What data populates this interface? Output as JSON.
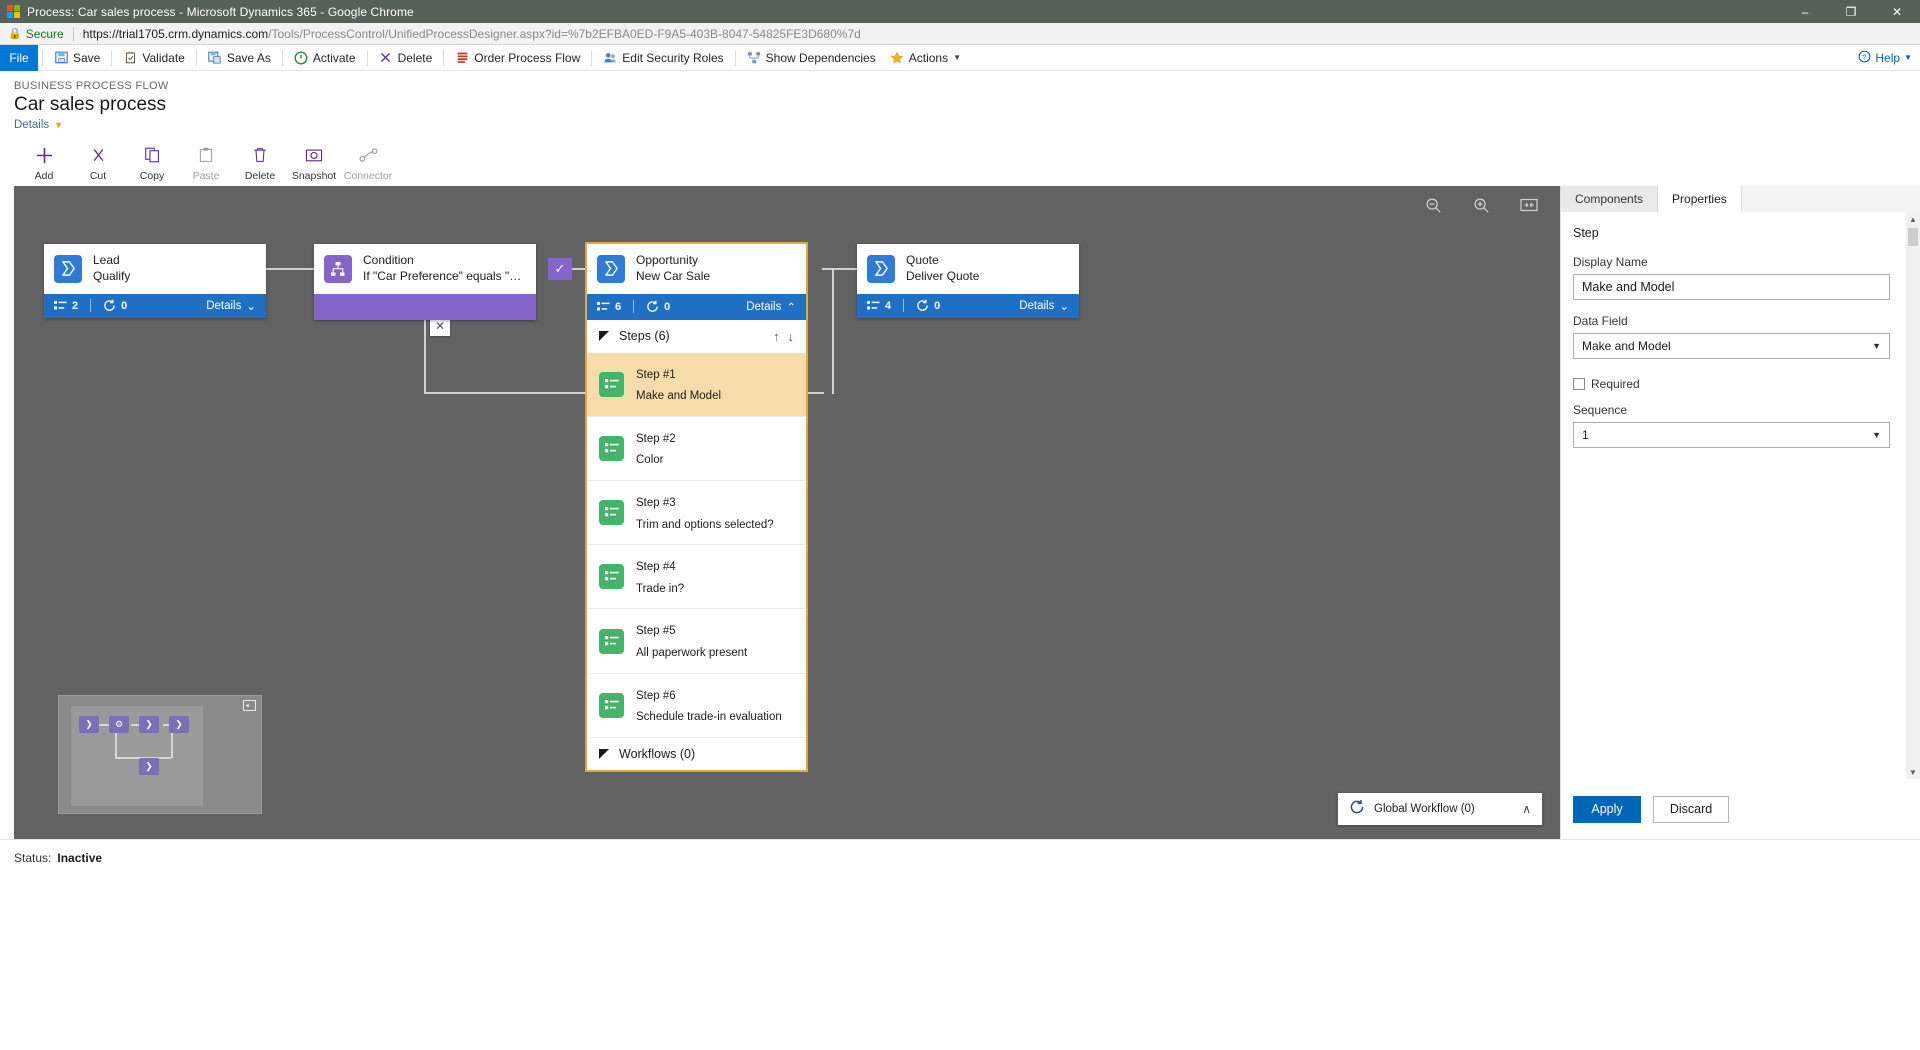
{
  "window": {
    "title": "Process: Car sales process - Microsoft Dynamics 365 - Google Chrome",
    "minimize": "–",
    "maximize": "❐",
    "close": "✕"
  },
  "address": {
    "secure_label": "Secure",
    "url_host": "https://trial1705.crm.dynamics.com",
    "url_path": "/Tools/ProcessControl/UnifiedProcessDesigner.aspx?id=%7b2EFBA0ED-F9A5-403B-8047-54825FE3D680%7d"
  },
  "commandbar": {
    "file": "File",
    "items": [
      {
        "label": "Save",
        "icon": "save-icon"
      },
      {
        "label": "Validate",
        "icon": "validate-icon"
      },
      {
        "label": "Save As",
        "icon": "save-as-icon"
      },
      {
        "label": "Activate",
        "icon": "activate-icon"
      },
      {
        "label": "Delete",
        "icon": "delete-icon"
      },
      {
        "label": "Order Process Flow",
        "icon": "order-process-flow-icon"
      },
      {
        "label": "Edit Security Roles",
        "icon": "edit-security-roles-icon"
      },
      {
        "label": "Show Dependencies",
        "icon": "show-dependencies-icon"
      },
      {
        "label": "Actions",
        "icon": "actions-icon"
      }
    ],
    "help": "Help"
  },
  "header": {
    "kicker": "BUSINESS PROCESS FLOW",
    "title": "Car sales process",
    "details": "Details"
  },
  "designtools": [
    {
      "label": "Add",
      "icon": "plus-icon",
      "disabled": false
    },
    {
      "label": "Cut",
      "icon": "scissors-icon",
      "disabled": false
    },
    {
      "label": "Copy",
      "icon": "copy-icon",
      "disabled": false
    },
    {
      "label": "Paste",
      "icon": "paste-icon",
      "disabled": true
    },
    {
      "label": "Delete",
      "icon": "trash-icon",
      "disabled": false
    },
    {
      "label": "Snapshot",
      "icon": "camera-icon",
      "disabled": false
    },
    {
      "label": "Connector",
      "icon": "connector-icon",
      "disabled": true
    }
  ],
  "canvas": {
    "zoom_out": "zoom-out-icon",
    "zoom_in": "zoom-in-icon",
    "fit": "fit-to-screen-icon",
    "stages": [
      {
        "name": "Lead",
        "subtitle": "Qualify",
        "steps_count": "2",
        "workflows_count": "0",
        "details": "Details",
        "color": "blue"
      },
      {
        "name": "Condition",
        "subtitle": "If \"Car Preference\" equals \"New ...",
        "steps_count": "",
        "workflows_count": "",
        "details": "",
        "color": "purple"
      },
      {
        "name": "Opportunity",
        "subtitle": "New Car Sale",
        "steps_count": "6",
        "workflows_count": "0",
        "details": "Details",
        "color": "blue"
      },
      {
        "name": "Quote",
        "subtitle": "Deliver Quote",
        "steps_count": "4",
        "workflows_count": "0",
        "details": "Details",
        "color": "blue"
      }
    ],
    "opportunity_panel": {
      "steps_section": "Steps (6)",
      "workflows_section": "Workflows (0)",
      "move_up": "↑",
      "move_down": "↓",
      "steps": [
        {
          "number": "Step #1",
          "label": "Make and Model",
          "selected": true
        },
        {
          "number": "Step #2",
          "label": "Color",
          "selected": false
        },
        {
          "number": "Step #3",
          "label": "Trim and options selected?",
          "selected": false
        },
        {
          "number": "Step #4",
          "label": "Trade in?",
          "selected": false
        },
        {
          "number": "Step #5",
          "label": "All paperwork present",
          "selected": false
        },
        {
          "number": "Step #6",
          "label": "Schedule trade-in evaluation",
          "selected": false
        }
      ]
    },
    "global_workflow": {
      "label": "Global Workflow (0)",
      "icon": "workflow-icon",
      "caret": "∧"
    },
    "minimap": {
      "expand_icon": "minimap-expand-icon"
    }
  },
  "properties": {
    "tabs": [
      {
        "label": "Components",
        "active": false
      },
      {
        "label": "Properties",
        "active": true
      }
    ],
    "section_title": "Step",
    "display_name_label": "Display Name",
    "display_name_value": "Make and Model",
    "data_field_label": "Data Field",
    "data_field_value": "Make and Model",
    "required_label": "Required",
    "required_checked": false,
    "sequence_label": "Sequence",
    "sequence_value": "1",
    "apply": "Apply",
    "discard": "Discard"
  },
  "statusbar": {
    "label": "Status:",
    "value": "Inactive"
  },
  "colors": {
    "accent_blue": "#0078d4",
    "stage_blue": "#2e7cd6",
    "stage_purple": "#8465cc",
    "step_green": "#45b46b",
    "selected_amber": "#f5dcaa",
    "selection_border": "#e0a93f",
    "canvas_gray": "#626262"
  }
}
